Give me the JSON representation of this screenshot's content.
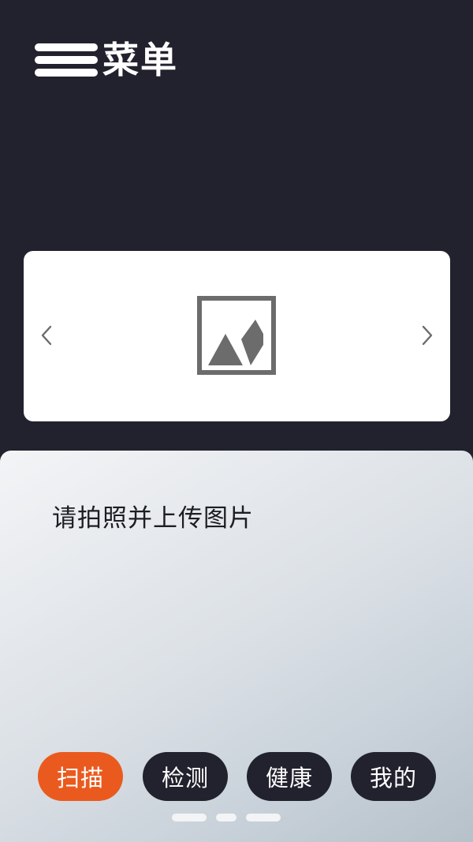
{
  "header": {
    "title": "菜单"
  },
  "carousel": {
    "image_icon": "image-placeholder-icon",
    "prev_icon": "chevron-left-icon",
    "next_icon": "chevron-right-icon"
  },
  "panel": {
    "prompt": "请拍照并上传图片"
  },
  "nav": {
    "items": [
      {
        "label": "扫描",
        "active": true
      },
      {
        "label": "检测",
        "active": false
      },
      {
        "label": "健康",
        "active": false
      },
      {
        "label": "我的",
        "active": false
      }
    ]
  },
  "colors": {
    "background": "#22222e",
    "accent": "#ea5a1e",
    "card": "#ffffff"
  }
}
